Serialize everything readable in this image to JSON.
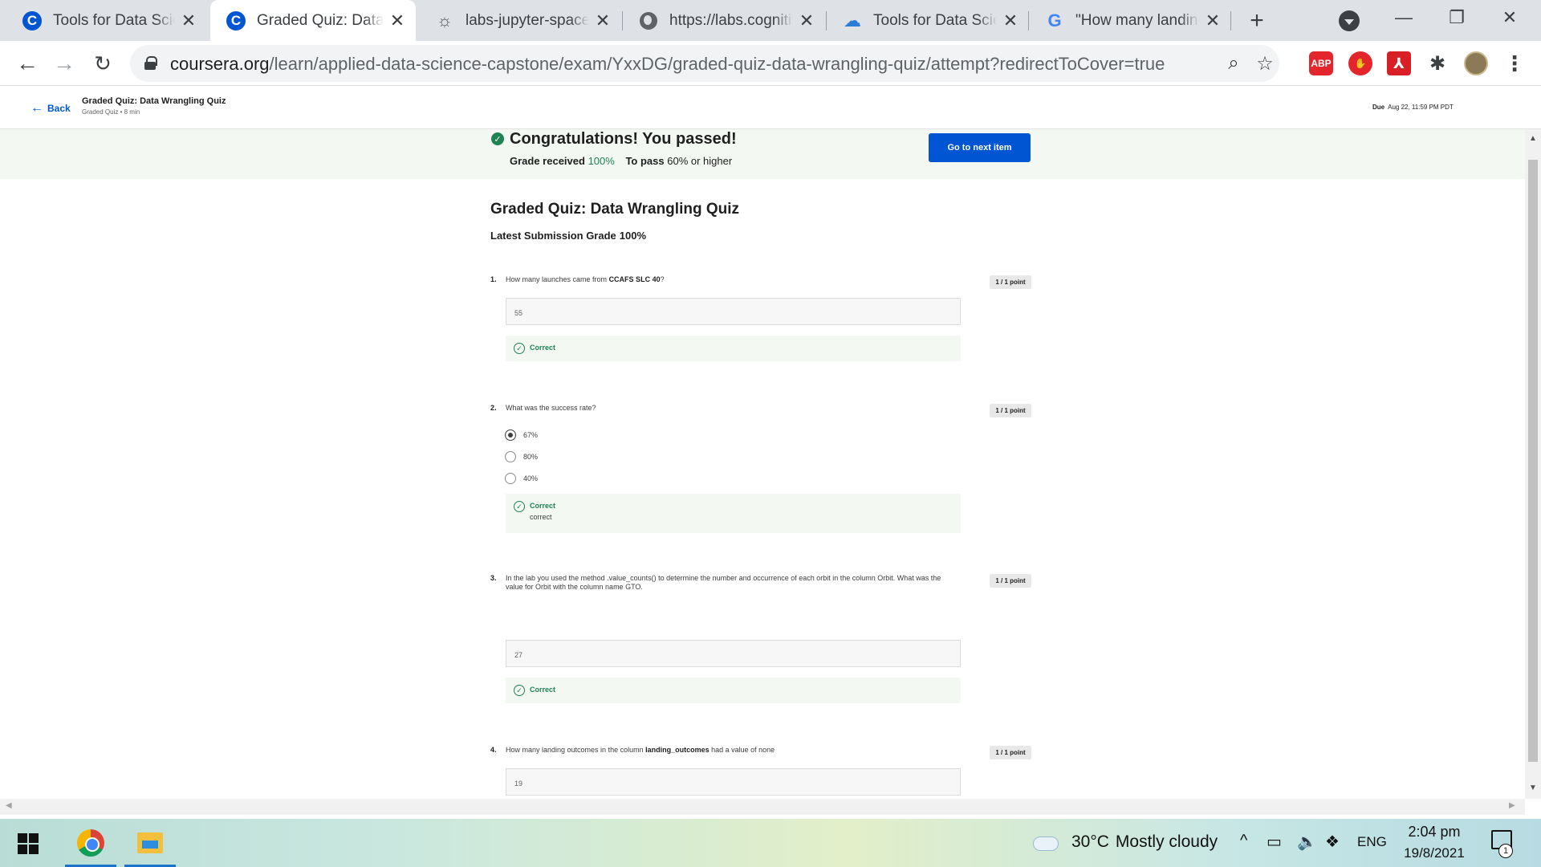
{
  "browser": {
    "tabs": [
      {
        "title": "Tools for Data Science",
        "icon": "coursera-icon",
        "active": false
      },
      {
        "title": "Graded Quiz: Data Wrangling Quiz",
        "icon": "coursera-icon",
        "active": true
      },
      {
        "title": "labs-jupyter-spacex",
        "icon": "jupyter-icon",
        "active": false
      },
      {
        "title": "https://labs.cognitiveclass.ai",
        "icon": "globe-icon",
        "active": false
      },
      {
        "title": "Tools for Data Science",
        "icon": "cloud-icon",
        "active": false
      },
      {
        "title": "\"How many landing outcomes",
        "icon": "google-icon",
        "active": false
      }
    ],
    "url_domain": "coursera.org",
    "url_path": "/learn/applied-data-science-capstone/exam/YxxDG/graded-quiz-data-wrangling-quiz/attempt?redirectToCover=true",
    "extensions": {
      "abp": "ABP"
    }
  },
  "course_header": {
    "back_label": "Back",
    "title": "Graded Quiz: Data Wrangling Quiz",
    "subtitle": "Graded Quiz • 8 min",
    "due_label": "Due",
    "due_date": "Aug 22, 11:59 PM PDT"
  },
  "banner": {
    "title": "Congratulations! You passed!",
    "grade_label": "Grade received",
    "grade_value": "100%",
    "pass_label": "To pass",
    "pass_value": "60% or higher",
    "next_button": "Go to next item"
  },
  "quiz": {
    "title": "Graded Quiz: Data Wrangling Quiz",
    "latest_label": "Latest Submission Grade",
    "latest_value": "100%",
    "questions": [
      {
        "num": "1.",
        "text_before": "How many launches came from ",
        "text_bold": "CCAFS SLC 40",
        "text_after": "?",
        "points": "1 / 1 point",
        "answer": "55",
        "feedback": "Correct"
      },
      {
        "num": "2.",
        "text": "What was the success rate?",
        "points": "1 / 1 point",
        "options": [
          "67%",
          "80%",
          "40%"
        ],
        "selected": 0,
        "feedback": "Correct",
        "explanation": "correct"
      },
      {
        "num": "3.",
        "text": "In the lab you used the method .value_counts() to determine the number and occurrence of each orbit in the column Orbit. What was the value for Orbit with the column name GTO.",
        "points": "1 / 1 point",
        "answer": "27",
        "feedback": "Correct"
      },
      {
        "num": "4.",
        "text_before": "How many landing outcomes in the column ",
        "text_bold": "landing_outcomes",
        "text_after": " had  a value of none",
        "points": "1 / 1 point",
        "answer": "19"
      }
    ]
  },
  "taskbar": {
    "temperature": "30°C",
    "weather": "Mostly cloudy",
    "language": "ENG",
    "time": "2:04 pm",
    "date": "19/8/2021",
    "notification_count": "1"
  },
  "colors": {
    "accent": "#0056d2",
    "success": "#1f8354",
    "banner_bg": "#f3f8f3"
  }
}
